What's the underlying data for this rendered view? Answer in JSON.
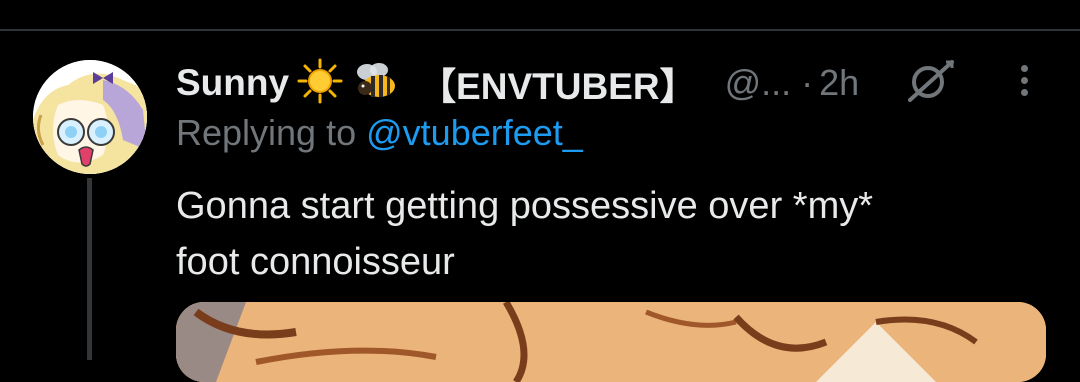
{
  "tweet": {
    "display_name": "Sunny",
    "name_emojis": [
      "sun-emoji",
      "bee-emoji"
    ],
    "name_suffix": "【ENVTUBER】",
    "handle": "@...",
    "separator": "·",
    "time": "2h",
    "reply_prefix": "Replying to",
    "reply_mention": "@vtuberfeet_",
    "text_lines": [
      "Gonna start getting possessive over *my*",
      "foot connoisseur"
    ],
    "icons": {
      "grok": "grok-slash-icon",
      "more": "more-vertical-icon"
    }
  },
  "colors": {
    "background": "#000000",
    "primary_text": "#e7e9ea",
    "secondary_text": "#71767b",
    "link": "#1d9bf0",
    "divider": "#2f3336"
  }
}
